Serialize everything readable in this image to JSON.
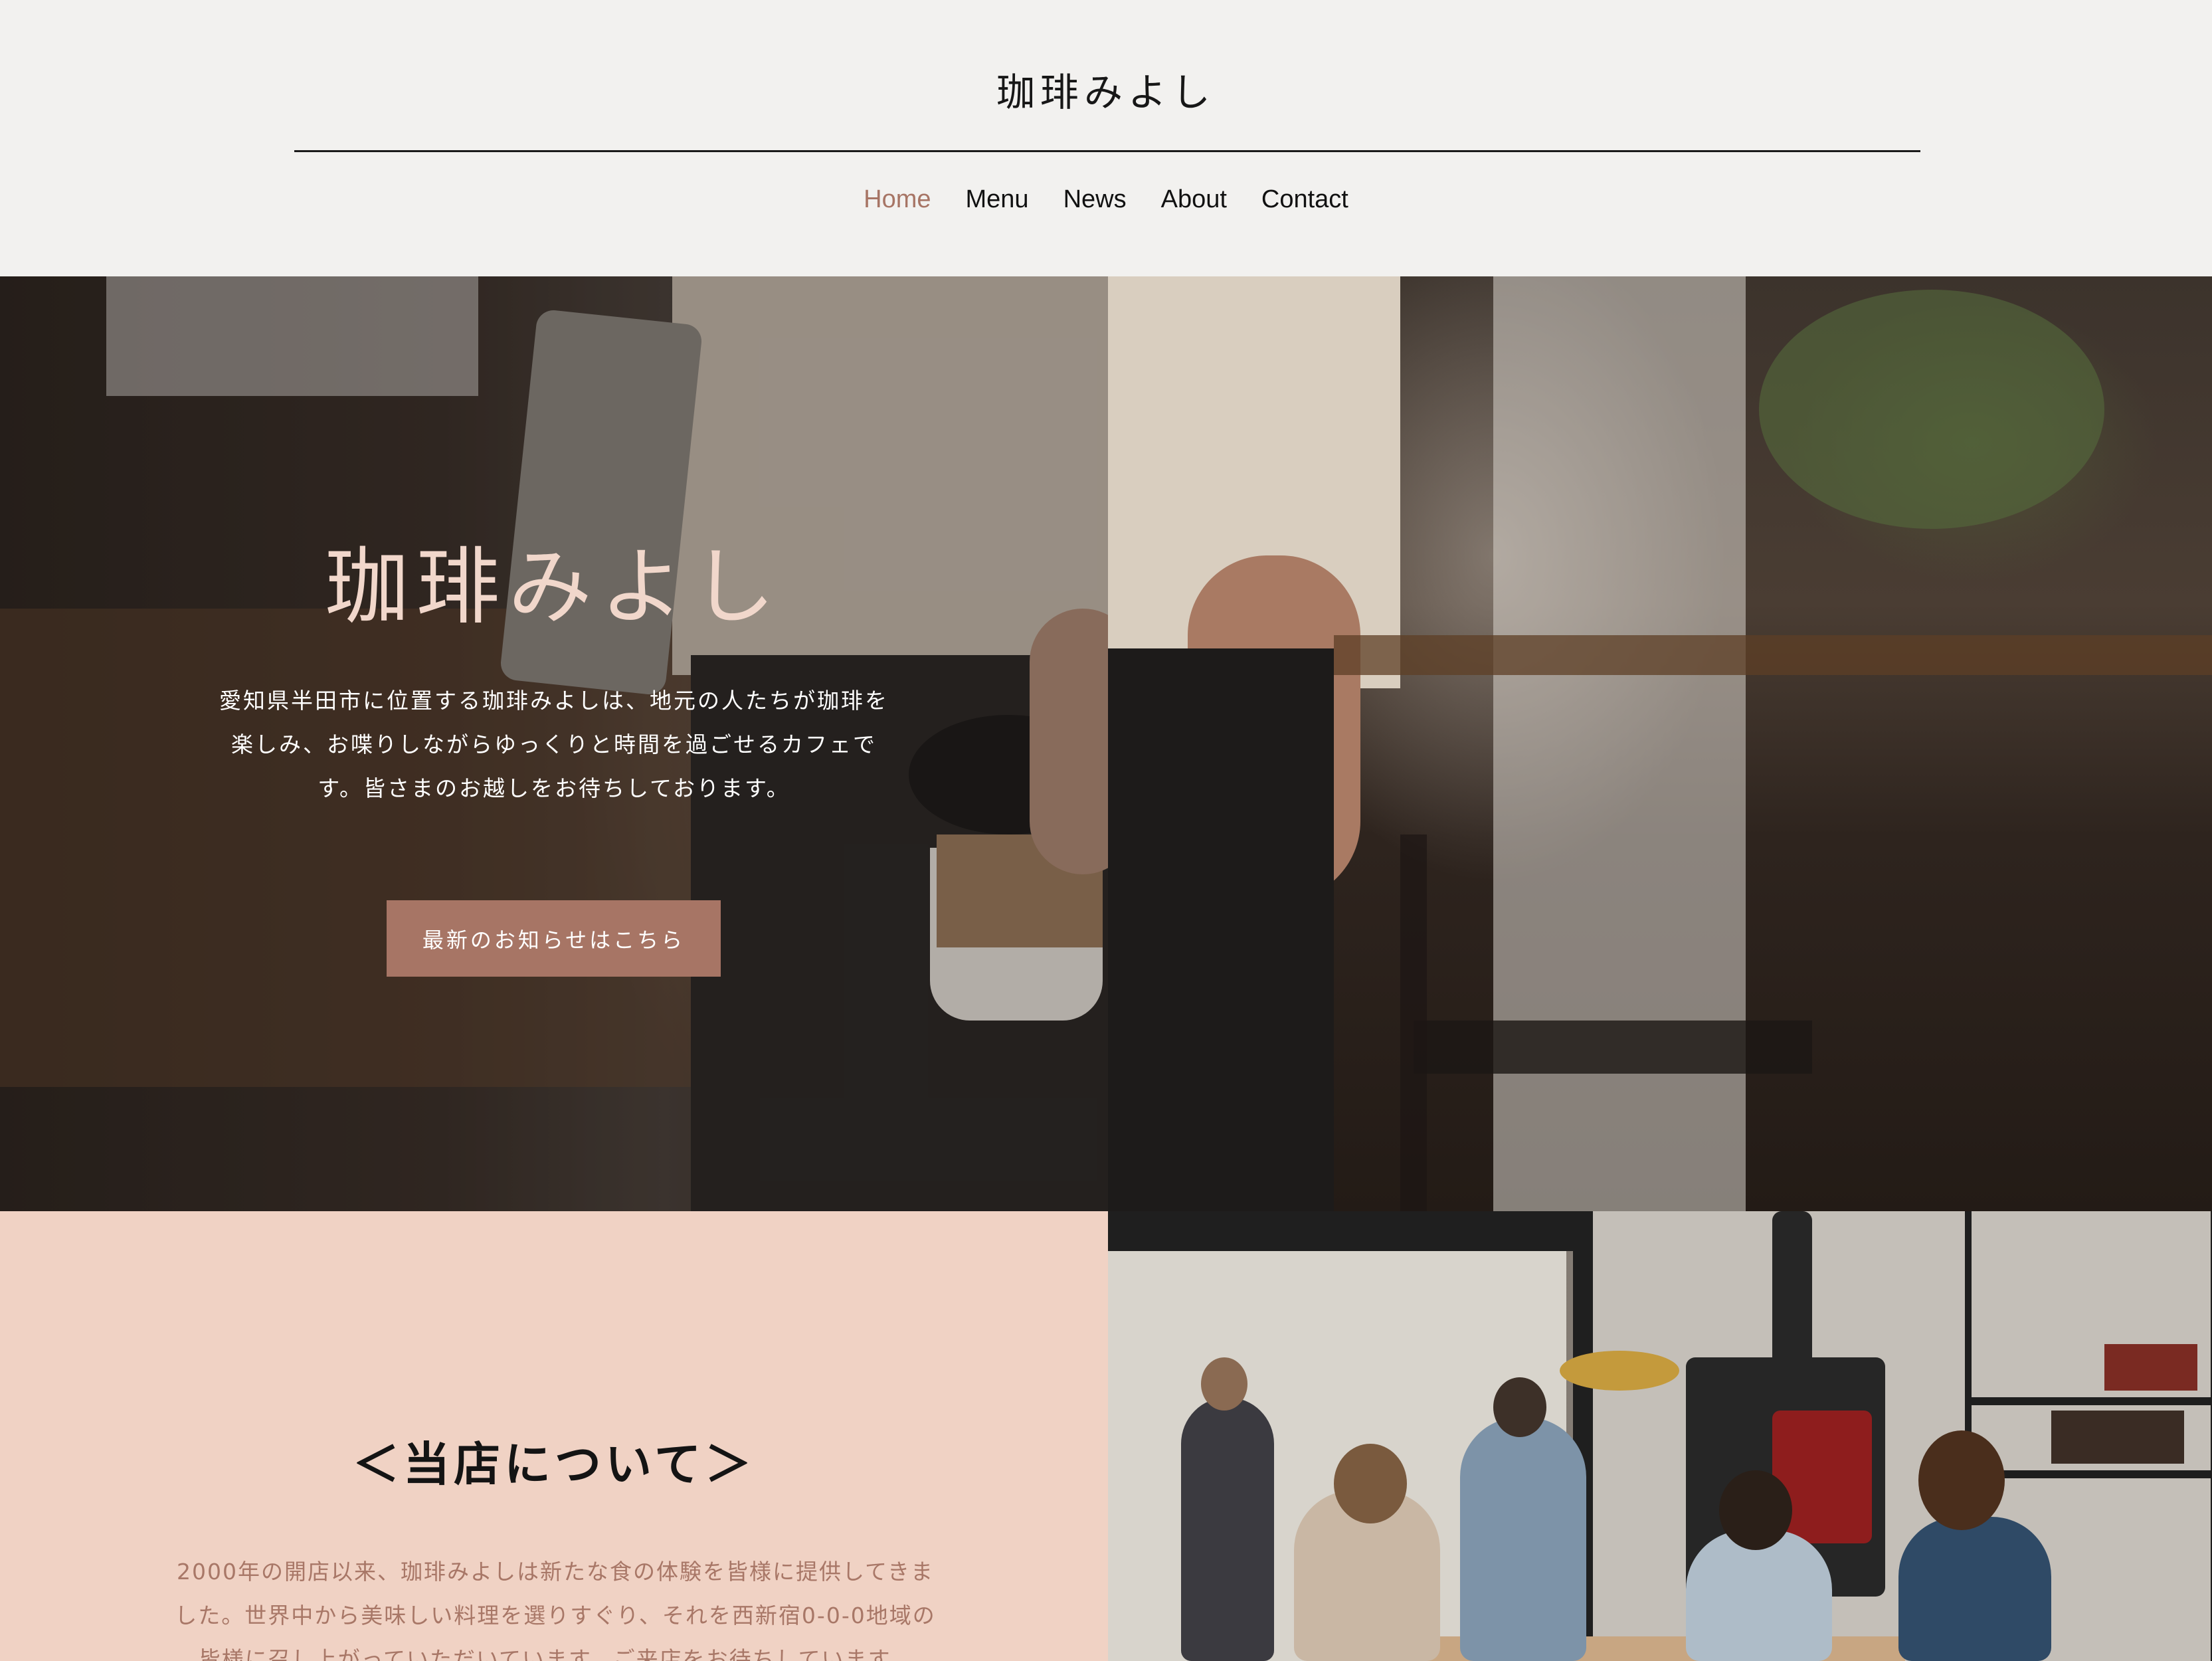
{
  "header": {
    "site_title": "珈琲みよし",
    "nav": [
      {
        "label": "Home",
        "active": true
      },
      {
        "label": "Menu",
        "active": false
      },
      {
        "label": "News",
        "active": false
      },
      {
        "label": "About",
        "active": false
      },
      {
        "label": "Contact",
        "active": false
      }
    ]
  },
  "hero": {
    "title": "珈琲みよし",
    "description_lines": [
      "愛知県半田市に位置する珈琲みよしは、地元の人たちが珈琲を",
      "楽しみ、お喋りしながらゆっくりと時間を過ごせるカフェで",
      "す。皆さまのお越しをお待ちしております。"
    ],
    "button_label": "最新のお知らせはこちら"
  },
  "about": {
    "heading": "＜当店について＞",
    "text_lines": [
      "2000年の開店以来、珈琲みよしは新たな食の体験を皆様に提供してきま",
      "した。世界中から美味しい料理を選りすぐり、それを西新宿0-0-0地域の",
      "皆様に召し上がっていただいています。ご来店をお待ちしています。"
    ]
  },
  "colors": {
    "accent": "#a77565",
    "header_bg": "#f2f1ef",
    "about_bg": "#f0d2c4",
    "hero_title": "#f1d7cb"
  }
}
